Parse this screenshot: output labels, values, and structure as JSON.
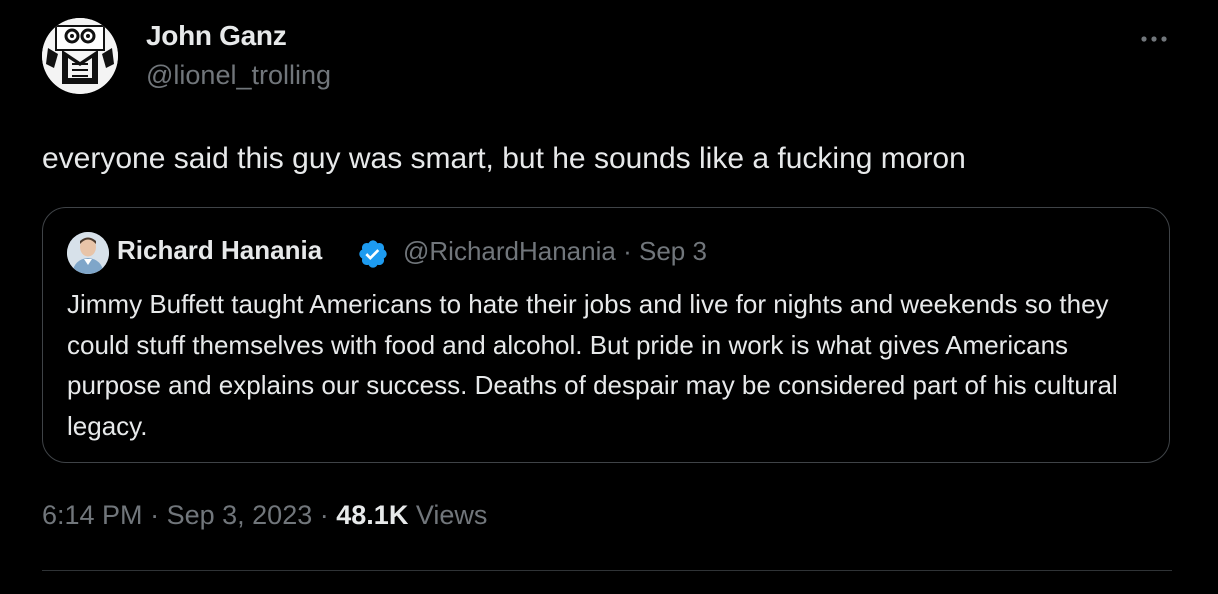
{
  "tweet": {
    "author_name": "John Ganz",
    "author_handle": "@lionel_trolling",
    "text": "everyone said this guy was smart, but he sounds like a fucking moron",
    "time": "6:14 PM",
    "date": "Sep 3, 2023",
    "separator": "·",
    "views_count": "48.1K",
    "views_label": "Views"
  },
  "quoted_tweet": {
    "author_name": "Richard Hanania",
    "author_handle": "@RichardHanania",
    "date": "Sep 3",
    "separator": "·",
    "text": "Jimmy Buffett taught Americans to hate their jobs and live for nights and weekends so they could stuff themselves with food and alcohol. But pride in work is what gives Americans purpose and explains our success. Deaths of despair may be considered part of his cultural legacy.",
    "verified": true
  },
  "icons": {
    "more": "more-options-icon",
    "verified": "verified-badge-icon"
  },
  "colors": {
    "background": "#000000",
    "text_primary": "#e7e9ea",
    "text_secondary": "#71767b",
    "border": "#3f4347",
    "verified_blue": "#1d9bf0"
  }
}
